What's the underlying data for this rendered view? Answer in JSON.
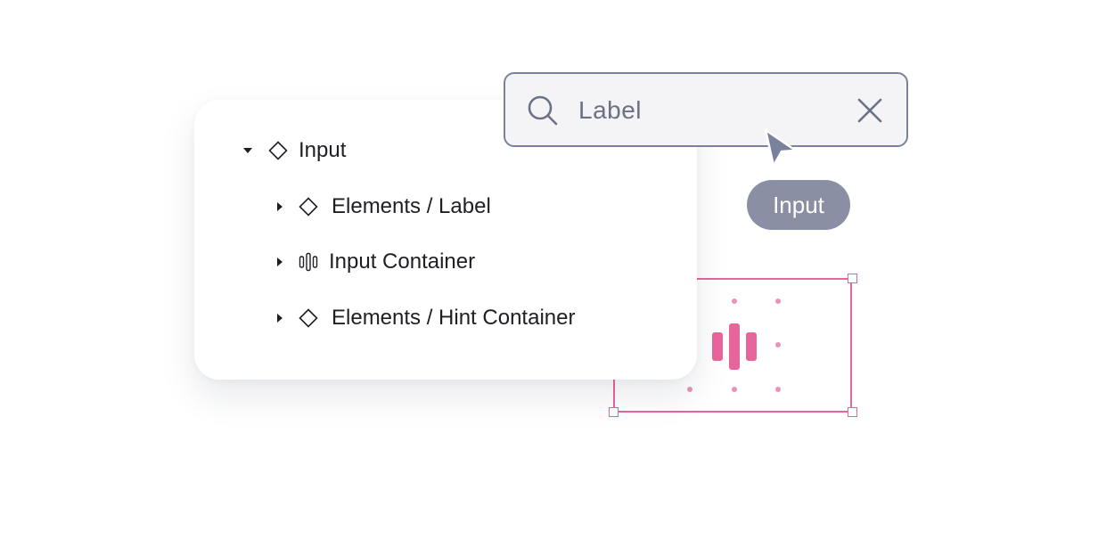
{
  "layers": {
    "root": {
      "label": "Input",
      "icon": "component-diamond-icon",
      "expanded": true
    },
    "children": [
      {
        "label": "Elements / Label",
        "icon": "component-diamond-icon",
        "expanded": false
      },
      {
        "label": "Input Container",
        "icon": "auto-layout-icon",
        "expanded": false
      },
      {
        "label": "Elements / Hint Container",
        "icon": "component-diamond-icon",
        "expanded": false
      }
    ]
  },
  "search": {
    "value": "Label",
    "search_icon": "search-icon",
    "clear_icon": "close-icon"
  },
  "tooltip": {
    "label": "Input"
  },
  "colors": {
    "selection": "#e8659b",
    "tooltip_bg": "#8a8fa3",
    "search_border": "#7a819b",
    "text": "#1e1f24"
  }
}
